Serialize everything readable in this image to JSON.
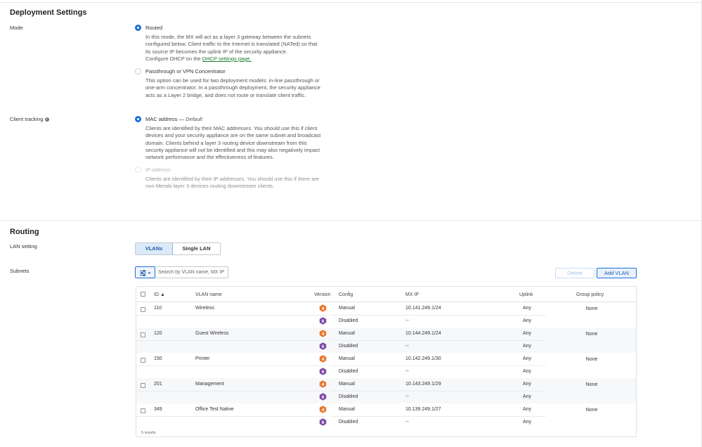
{
  "deployment": {
    "title": "Deployment Settings",
    "mode_label": "Mode",
    "routed": {
      "label": "Routed",
      "desc_1": "In this mode, the MX will act as a layer 3 gateway between the subnets",
      "desc_2": "configured below. Client traffic to the Internet is translated (NATed) so that",
      "desc_3": "its source IP becomes the uplink IP of the security appliance.",
      "desc_4": "Configure DHCP on the",
      "link": "DHCP settings page."
    },
    "passthrough": {
      "label": "Passthrough or VPN Concentrator",
      "desc_1": "This option can be used for two deployment models: in-line passthrough or",
      "desc_2": "one-arm concentrator. In a passthrough deployment, the security appliance",
      "desc_3": "acts as a Layer 2 bridge, and does not route or translate client traffic."
    },
    "client_tracking_label": "Client tracking",
    "info_icon_glyph": "i",
    "mac": {
      "label": "MAC address —",
      "default": "Default",
      "desc_1": "Clients are identified by their MAC addresses. You should use this if client",
      "desc_2": "devices and your security appliance are on the same subnet and broadcast",
      "desc_3": "domain. Clients behind a layer 3 routing device downstream from this",
      "desc_4a": "security appliance will",
      "desc_4b": "not",
      "desc_4c": "be identified and this may also negatively impact",
      "desc_5": "network performance and the effectiveness of features."
    },
    "ip": {
      "label": "IP address",
      "desc_1": "Clients are identified by their IP addresses. You should use this if there are",
      "desc_2": "non-Meraki layer 3 devices routing downstream clients."
    }
  },
  "routing": {
    "title": "Routing",
    "lan_setting_label": "LAN setting",
    "lan_options": [
      "VLANs",
      "Single LAN"
    ],
    "subnets_label": "Subnets",
    "search_placeholder": "Search by VLAN name, MX IP",
    "delete_label": "Delete",
    "add_label": "Add VLAN"
  },
  "table": {
    "columns": [
      "ID ▲",
      "VLAN name",
      "Version",
      "Config",
      "MX IP",
      "Uplink",
      "Group policy"
    ],
    "rows": [
      {
        "id": "110",
        "name": "Wireless",
        "v4_config": "Manual",
        "v4_ip": "10.141.249.1/24",
        "v4_uplink": "Any",
        "v6_config": "Disabled",
        "v6_ip": "--",
        "v6_uplink": "Any",
        "policy": "None"
      },
      {
        "id": "120",
        "name": "Guest Wireless",
        "v4_config": "Manual",
        "v4_ip": "10.144.249.1/24",
        "v4_uplink": "Any",
        "v6_config": "Disabled",
        "v6_ip": "--",
        "v6_uplink": "Any",
        "policy": "None"
      },
      {
        "id": "150",
        "name": "Printer",
        "v4_config": "Manual",
        "v4_ip": "10.142.249.1/30",
        "v4_uplink": "Any",
        "v6_config": "Disabled",
        "v6_ip": "--",
        "v6_uplink": "Any",
        "policy": "None"
      },
      {
        "id": "201",
        "name": "Management",
        "v4_config": "Manual",
        "v4_ip": "10.143.249.1/29",
        "v4_uplink": "Any",
        "v6_config": "Disabled",
        "v6_ip": "--",
        "v6_uplink": "Any",
        "policy": "None"
      },
      {
        "id": "349",
        "name": "Office Test Native",
        "v4_config": "Manual",
        "v4_ip": "10.139.249.1/27",
        "v4_uplink": "Any",
        "v6_config": "Disabled",
        "v6_ip": "--",
        "v6_uplink": "Any",
        "policy": "None"
      }
    ],
    "v4_badge": "4",
    "v6_badge": "6",
    "results": "5 results"
  },
  "colors": {
    "accent": "#1f6fd6",
    "ipv4_badge": "#e8772e",
    "ipv6_badge": "#7b4aa8",
    "link": "#1a7e2a"
  },
  "icons": {
    "filter": "filter-sliders-icon",
    "dropdown": "chevron-down-icon",
    "info": "info-icon",
    "ipv4": "ipv4-badge-icon",
    "ipv6": "ipv6-badge-icon"
  }
}
